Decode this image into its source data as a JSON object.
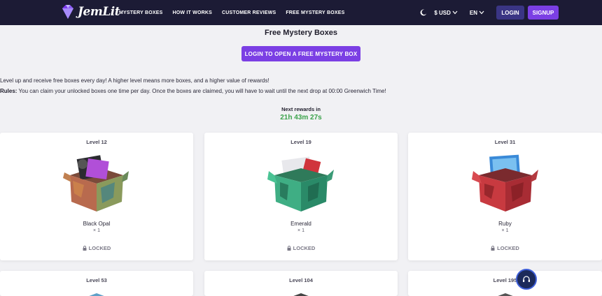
{
  "nav": {
    "logo_text": "JemLit",
    "links": [
      "MYSTERY BOXES",
      "HOW IT WORKS",
      "CUSTOMER REVIEWS",
      "FREE MYSTERY BOXES"
    ],
    "currency": "$ USD",
    "language": "EN",
    "login_label": "LOGIN",
    "signup_label": "SIGNUP"
  },
  "hero": {
    "title": "Free Mystery Boxes",
    "cta_label": "LOGIN TO OPEN A FREE MYSTERY BOX",
    "intro": "Level up and receive free boxes every day! A higher level means more boxes, and a higher value of rewards!",
    "rules_label": "Rules:",
    "rules_text": " You can claim your unlocked boxes one time per day. Once the boxes are claimed, you will have to wait until the next drop at 00:00 Greenwich Time!",
    "next_rewards_label": "Next rewards in",
    "countdown": "21h 43m 27s"
  },
  "cards": [
    {
      "level": "Level 12",
      "name": "Black Opal",
      "qty": "× 1",
      "status": "LOCKED",
      "color": "#c46a4a"
    },
    {
      "level": "Level 19",
      "name": "Emerald",
      "qty": "× 1",
      "status": "LOCKED",
      "color": "#3aa37a"
    },
    {
      "level": "Level 31",
      "name": "Ruby",
      "qty": "× 1",
      "status": "LOCKED",
      "color": "#b8353a"
    },
    {
      "level": "Level 53"
    },
    {
      "level": "Level 104"
    },
    {
      "level": "Level 195"
    }
  ],
  "colors": {
    "nav_bg": "#1c1b35",
    "accent": "#7b3fe4",
    "countdown": "#3aa24a"
  }
}
